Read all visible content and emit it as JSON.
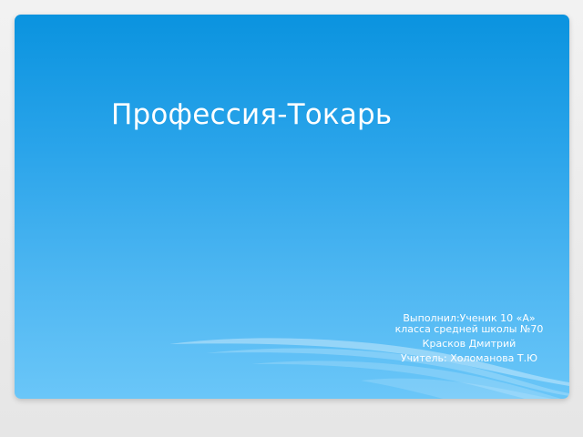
{
  "slide": {
    "title": "Профессия-Токарь",
    "subtitle": {
      "line1": "Выполнил:Ученик 10 «А» класса средней школы №70",
      "line2": "Красков Дмитрий",
      "line3": "Учитель: Холоманова Т.Ю"
    }
  },
  "colors": {
    "background_top": "#0a93df",
    "background_bottom": "#6ac6f8",
    "frame": "#e9e9e9",
    "text": "#ffffff"
  }
}
